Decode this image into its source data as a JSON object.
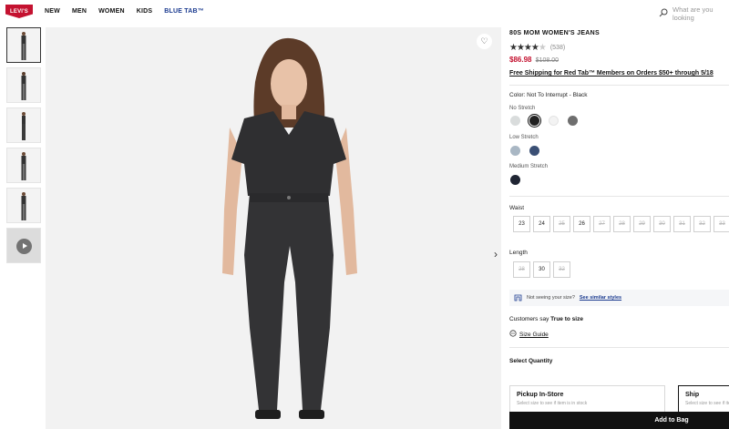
{
  "header": {
    "logo_text": "LEVI'S",
    "nav": [
      "NEW",
      "MEN",
      "WOMEN",
      "KIDS",
      "BLUE TAB™"
    ],
    "search_placeholder": "What are you looking"
  },
  "product": {
    "title": "80S MOM WOMEN'S JEANS",
    "rating": 4,
    "review_count": "(538)",
    "sale_price": "$86.98",
    "original_price": "$108.00",
    "shipping_banner": "Free Shipping for Red Tab™ Members on Orders $50+ through 5/18"
  },
  "color": {
    "label": "Color:",
    "selected": "Not To Interrupt - Black",
    "groups": [
      {
        "name": "No Stretch",
        "swatches": [
          "#d9dcdc",
          "#222222",
          "#f3f3f3",
          "#6e6e6e"
        ]
      },
      {
        "name": "Low Stretch",
        "swatches": [
          "#a9b7c4",
          "#3a4f74"
        ]
      },
      {
        "name": "Medium Stretch",
        "swatches": [
          "#1f2533"
        ]
      }
    ]
  },
  "waist": {
    "label": "Waist",
    "sizes": [
      "23",
      "24",
      "25",
      "26",
      "27",
      "28",
      "29",
      "30",
      "31",
      "32",
      "33"
    ],
    "available": [
      true,
      true,
      false,
      true,
      false,
      false,
      false,
      false,
      false,
      false,
      false
    ]
  },
  "length": {
    "label": "Length",
    "sizes": [
      "28",
      "30",
      "32"
    ],
    "available": [
      false,
      true,
      false
    ]
  },
  "fit": {
    "text": "Not seeing your size?",
    "link": "See similar styles"
  },
  "customers_say": {
    "prefix": "Customers say",
    "value": "True to size"
  },
  "size_guide": "Size Guide",
  "quantity_label": "Select Quantity",
  "fulfillment": {
    "pickup_title": "Pickup In-Store",
    "pickup_sub": "Select size to see if item is in stock",
    "ship_title": "Ship",
    "ship_sub": "Select size to see if item"
  },
  "add_to_bag": "Add to Bag",
  "colors": {
    "brand_red": "#c41230",
    "blue_tab": "#1a3a8f"
  }
}
